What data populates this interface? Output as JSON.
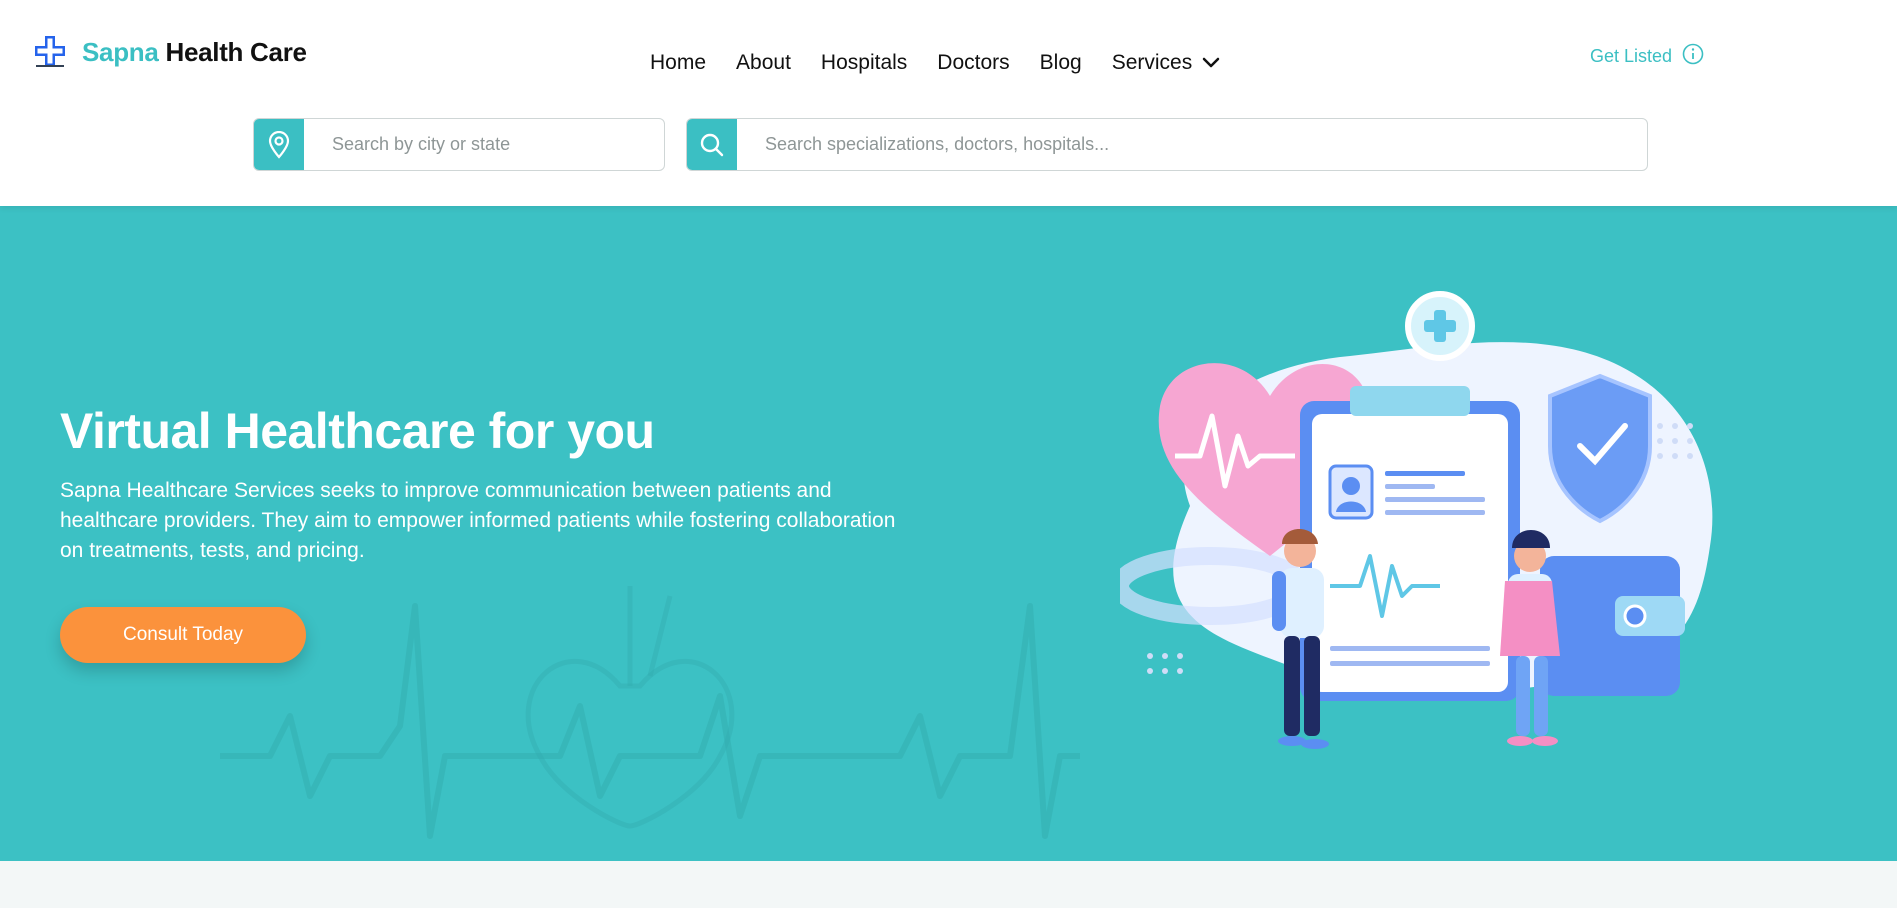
{
  "brand": {
    "name_part1": "Sapna",
    "name_part2": "Health Care"
  },
  "nav": {
    "items": [
      {
        "label": "Home"
      },
      {
        "label": "About"
      },
      {
        "label": "Hospitals"
      },
      {
        "label": "Doctors"
      },
      {
        "label": "Blog"
      },
      {
        "label": "Services"
      }
    ],
    "get_listed": "Get Listed"
  },
  "search": {
    "location_placeholder": "Search by city or state",
    "main_placeholder": "Search specializations, doctors, hospitals..."
  },
  "hero": {
    "title": "Virtual Healthcare for you",
    "description": "Sapna Healthcare Services seeks to improve communication between patients and healthcare providers. They aim to empower informed patients while fostering collaboration on treatments, tests, and pricing.",
    "cta_label": "Consult Today"
  },
  "icons": {
    "logo": "medical-cross-logo",
    "location": "location-pin-icon",
    "search": "search-icon",
    "info": "info-icon",
    "chevron": "chevron-down-icon"
  },
  "colors": {
    "accent": "#3bbfc3",
    "hero_bg": "#3cc1c4",
    "cta": "#fb923c",
    "footer_bg": "#f3f7f7"
  }
}
